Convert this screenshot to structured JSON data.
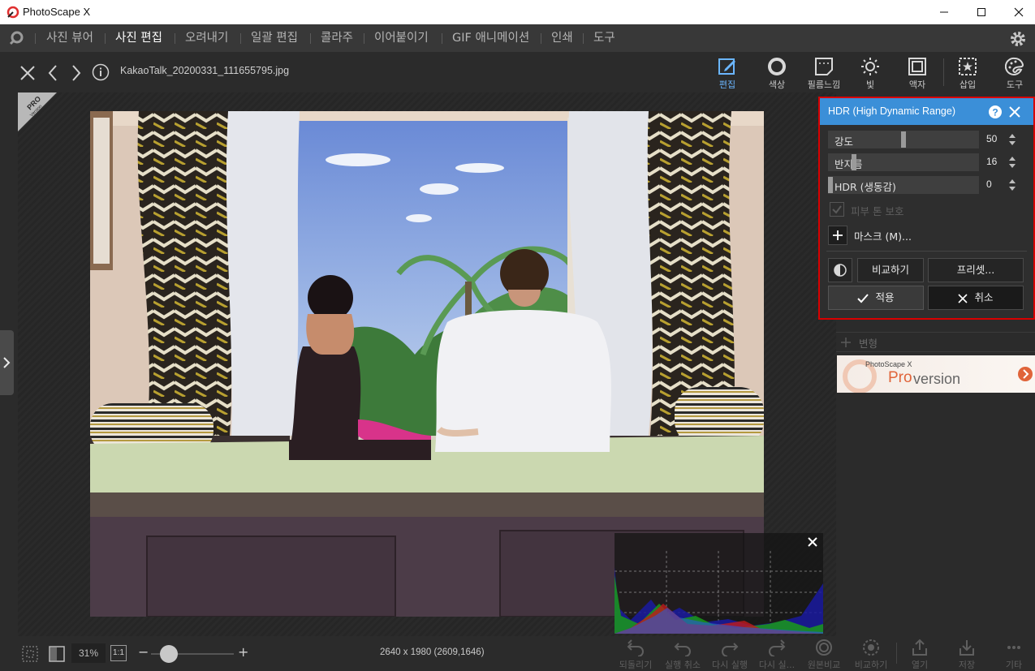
{
  "window": {
    "title": "PhotoScape X"
  },
  "menu": {
    "items": [
      "사진 뷰어",
      "사진 편집",
      "오려내기",
      "일괄 편집",
      "콜라주",
      "이어붙이기",
      "GIF 애니메이션",
      "인쇄",
      "도구"
    ],
    "active": "사진 편집"
  },
  "toolbar": {
    "filename": "KakaoTalk_20200331_111655795.jpg",
    "tools": [
      {
        "label": "편집",
        "icon": "edit-icon",
        "active": true
      },
      {
        "label": "색상",
        "icon": "color-icon",
        "active": false
      },
      {
        "label": "필름느낌",
        "icon": "film-icon",
        "active": false
      },
      {
        "label": "빛",
        "icon": "light-icon",
        "active": false
      },
      {
        "label": "액자",
        "icon": "frame-icon",
        "active": false
      },
      {
        "label": "삽입",
        "icon": "insert-icon",
        "active": false
      },
      {
        "label": "도구",
        "icon": "tools-icon",
        "active": false
      }
    ]
  },
  "badge": {
    "pro": "PRO",
    "version": "Version"
  },
  "hdr_panel": {
    "title": "HDR (High Dynamic Range)",
    "sliders": [
      {
        "label": "강도",
        "value": "50",
        "fraction": 0.5
      },
      {
        "label": "반지름",
        "value": "16",
        "fraction": 0.16
      },
      {
        "label": "HDR (생동감)",
        "value": "0",
        "fraction": 0.0
      }
    ],
    "skin_protect": "피부 톤 보호",
    "mask": "마스크 (M)...",
    "compare": "비교하기",
    "preset": "프리셋...",
    "apply": "적용",
    "cancel": "취소"
  },
  "side_items": [
    "변형"
  ],
  "pro_banner": {
    "small": "PhotoScape X",
    "pro": "Pro",
    "version": " version"
  },
  "statusbar": {
    "zoom": "31%",
    "one_to_one": "1:1",
    "minus": "−",
    "plus": "+",
    "dimensions": "2640 x 1980 (2609,1646)",
    "zoom_level": 0.31
  },
  "bottom_actions": [
    "되돌리기",
    "실행 취소",
    "다시 실행",
    "다시 실...",
    "원본비교",
    "비교하기",
    "열기",
    "저장",
    "기타"
  ],
  "colors": {
    "accent": "#3b8fd8",
    "highlight_border": "#d90000",
    "active_tool": "#6bb6ff"
  }
}
